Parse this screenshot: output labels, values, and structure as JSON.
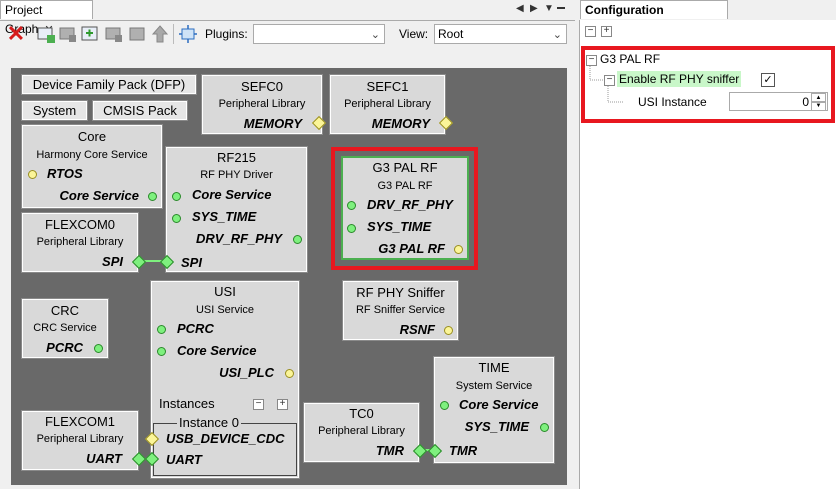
{
  "left_tab": {
    "label": "Project Graph",
    "close": "✕"
  },
  "right_tab": {
    "label": "Configuration Options",
    "close": "✕"
  },
  "toolbar": {
    "plugins_label": "Plugins:",
    "plugins_value": "",
    "view_label": "View:",
    "view_value": "Root"
  },
  "buttons": {
    "dfp": "Device Family Pack (DFP)",
    "system": "System",
    "cmsis": "CMSIS Pack"
  },
  "nodes": {
    "sefc0": {
      "title": "SEFC0",
      "sub": "Peripheral Library",
      "port": "MEMORY"
    },
    "sefc1": {
      "title": "SEFC1",
      "sub": "Peripheral Library",
      "port": "MEMORY"
    },
    "core": {
      "title": "Core",
      "sub": "Harmony Core Service",
      "p1": "RTOS",
      "p2": "Core Service"
    },
    "rf215": {
      "title": "RF215",
      "sub": "RF PHY Driver",
      "p1": "Core Service",
      "p2": "SYS_TIME",
      "p3": "DRV_RF_PHY",
      "p4": "SPI"
    },
    "g3pal": {
      "title": "G3 PAL RF",
      "sub": "G3 PAL RF",
      "p1": "DRV_RF_PHY",
      "p2": "SYS_TIME",
      "p3": "G3 PAL RF"
    },
    "flexcom0": {
      "title": "FLEXCOM0",
      "sub": "Peripheral Library",
      "port": "SPI"
    },
    "crc": {
      "title": "CRC",
      "sub": "CRC Service",
      "port": "PCRC"
    },
    "usi": {
      "title": "USI",
      "sub": "USI Service",
      "p1": "PCRC",
      "p2": "Core Service",
      "p3": "USI_PLC",
      "instances": "Instances",
      "instance0": "Instance 0",
      "p4": "USB_DEVICE_CDC",
      "p5": "UART"
    },
    "sniffer": {
      "title": "RF PHY Sniffer",
      "sub": "RF Sniffer Service",
      "port": "RSNF"
    },
    "time": {
      "title": "TIME",
      "sub": "System Service",
      "p1": "Core Service",
      "p2": "SYS_TIME",
      "p3": "TMR"
    },
    "flexcom1": {
      "title": "FLEXCOM1",
      "sub": "Peripheral Library",
      "port": "UART"
    },
    "tc0": {
      "title": "TC0",
      "sub": "Peripheral Library",
      "port": "TMR"
    }
  },
  "config": {
    "root": "G3 PAL RF",
    "option": "Enable RF PHY sniffer",
    "option_checked": "✓",
    "usi_label": "USI Instance",
    "usi_value": "0"
  },
  "colors": {
    "highlight": "#e8171f",
    "green_port": "#7ef07e",
    "yellow_port": "#fbf598",
    "selected_bg": "#c9f7c9"
  }
}
